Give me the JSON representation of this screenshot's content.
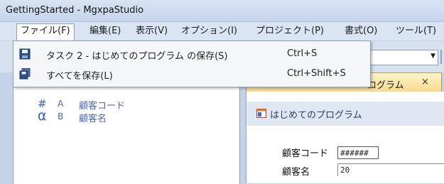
{
  "window": {
    "title": "GettingStarted - MgxpaStudio"
  },
  "menubar": {
    "items": [
      {
        "label": "ファイル(F)"
      },
      {
        "label": "編集(E)"
      },
      {
        "label": "表示(V)"
      },
      {
        "label": "オプション(I)"
      },
      {
        "label": "プロジェクト(P)"
      },
      {
        "label": "書式(O)"
      },
      {
        "label": "ツール(T)"
      }
    ]
  },
  "file_menu": {
    "items": [
      {
        "label": "タスク 2  - はじめてのプログラム の保存(S)",
        "shortcut": "Ctrl+S",
        "icon": "save-icon"
      },
      {
        "label": "すべてを保存(L)",
        "shortcut": "Ctrl+Shift+S",
        "icon": "save-all-icon"
      }
    ]
  },
  "editor_tab": {
    "label": "ログラム",
    "close": "×"
  },
  "variables": [
    {
      "symbol": "#",
      "letter": "A",
      "name": "顧客コード"
    },
    {
      "symbol": "α",
      "letter": "B",
      "name": "顧客名"
    }
  ],
  "form": {
    "title": "はじめてのプログラム",
    "fields": [
      {
        "label": "顧客コード",
        "value": "######"
      },
      {
        "label": "顧客名",
        "value": "20"
      }
    ]
  },
  "colors": {
    "accent": "#3b5fb0",
    "menu_bg": "#dae4f2",
    "tab_active": "#f7d98f"
  }
}
